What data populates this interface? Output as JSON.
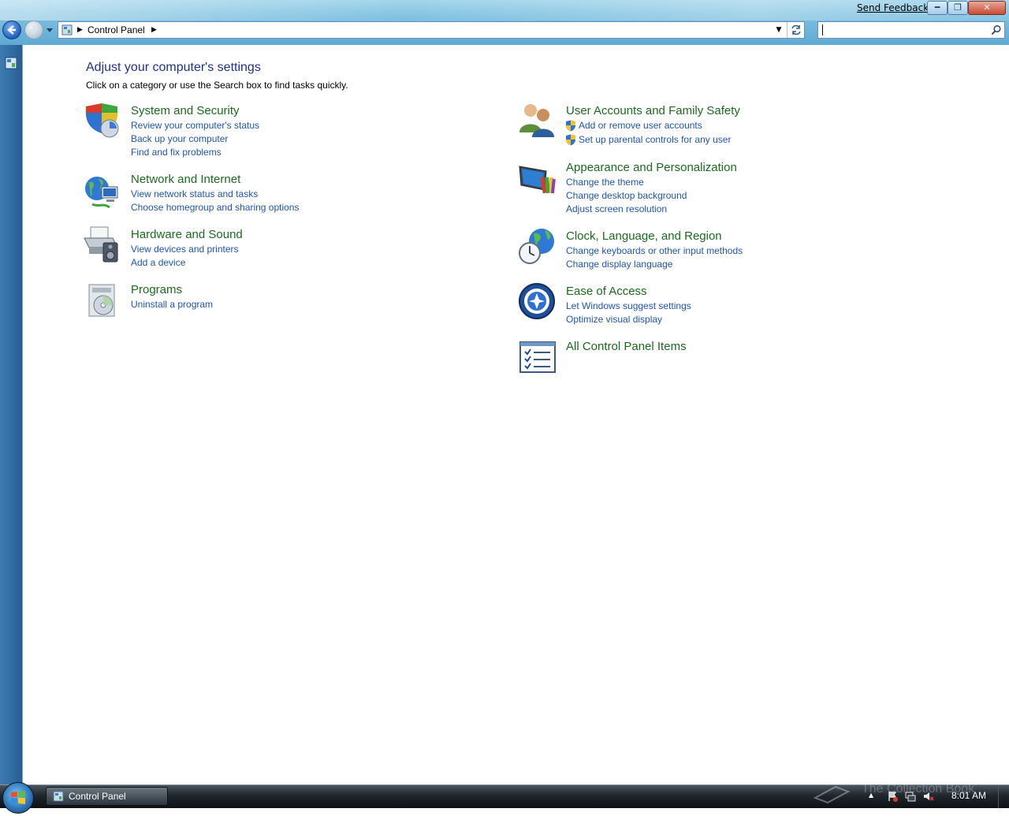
{
  "window": {
    "feedback_link": "Send Feedback",
    "address": {
      "path": "Control Panel"
    }
  },
  "content": {
    "heading": "Adjust your computer's settings",
    "subheading": "Click on a category or use the Search box to find tasks quickly.",
    "categories": [
      {
        "title": "System and Security",
        "icon": "shield-security-icon",
        "links": [
          "Review your computer's status",
          "Back up your computer",
          "Find and fix problems"
        ]
      },
      {
        "title": "Network and Internet",
        "icon": "network-globe-icon",
        "links": [
          "View network status and tasks",
          "Choose homegroup and sharing options"
        ]
      },
      {
        "title": "Hardware and Sound",
        "icon": "printer-speaker-icon",
        "links": [
          "View devices and printers",
          "Add a device"
        ]
      },
      {
        "title": "Programs",
        "icon": "programs-disc-icon",
        "links": [
          "Uninstall a program"
        ]
      },
      {
        "title": "User Accounts and Family Safety",
        "icon": "users-icon",
        "links": [
          "Add or remove user accounts",
          "Set up parental controls for any user"
        ]
      },
      {
        "title": "Appearance and Personalization",
        "icon": "monitor-colors-icon",
        "links": [
          "Change the theme",
          "Change desktop background",
          "Adjust screen resolution"
        ]
      },
      {
        "title": "Clock, Language, and Region",
        "icon": "clock-globe-icon",
        "links": [
          "Change keyboards or other input methods",
          "Change display language"
        ]
      },
      {
        "title": "Ease of Access",
        "icon": "ease-of-access-icon",
        "links": [
          "Let Windows suggest settings",
          "Optimize visual display"
        ]
      },
      {
        "title": "All Control Panel Items",
        "icon": "checklist-icon",
        "links": []
      }
    ]
  },
  "taskbar": {
    "window_button": "Control Panel",
    "clock": "8:01 AM",
    "watermark": "The Collection Book"
  },
  "colors": {
    "category_title": "#1b6b1e",
    "link": "#1e55b3",
    "heading": "#1e3287"
  }
}
